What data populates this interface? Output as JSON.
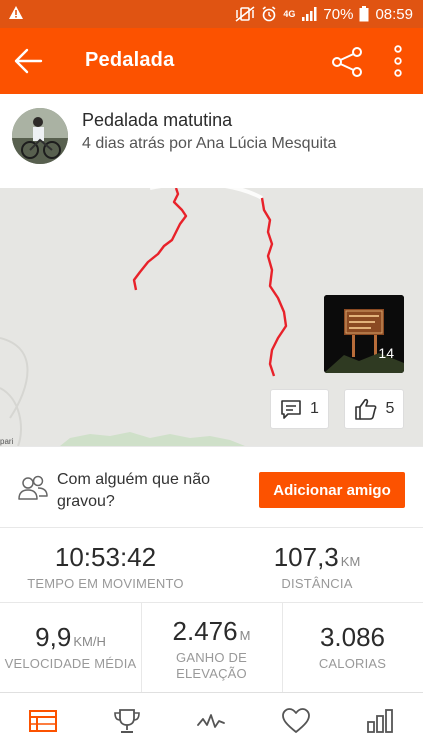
{
  "status_bar": {
    "battery": "70%",
    "time": "08:59",
    "network": "4G",
    "icons": [
      "warning-icon",
      "mute-vibrate-icon",
      "alarm-icon",
      "network-4g-icon",
      "signal-icon",
      "battery-icon"
    ]
  },
  "app_bar": {
    "title": "Pedalada",
    "icons": [
      "back-arrow-icon",
      "share-icon",
      "more-vertical-icon"
    ]
  },
  "activity": {
    "title": "Pedalada matutina",
    "subtitle": "4 dias atrás por Ana Lúcia Mesquita"
  },
  "map": {
    "photo_count": "14",
    "comments_count": "1",
    "kudos_count": "5",
    "brand_fragment": "pari",
    "route_color": "#e8222a"
  },
  "friend_prompt": {
    "question": "Com alguém que não gravou?",
    "button_label": "Adicionar amigo"
  },
  "stats": {
    "moving_time": {
      "value": "10:53:42",
      "label": "TEMPO EM MOVIMENTO"
    },
    "distance": {
      "value": "107,3",
      "unit": "KM",
      "label": "DISTÂNCIA"
    },
    "avg_speed": {
      "value": "9,9",
      "unit": "KM/H",
      "label": "VELOCIDADE MÉDIA"
    },
    "elevation": {
      "value": "2.476",
      "unit": "M",
      "label": "GANHO DE ELEVAÇÃO"
    },
    "calories": {
      "value": "3.086",
      "label": "CALORIAS"
    }
  },
  "bottom_nav": {
    "items": [
      "feed-icon",
      "trophy-icon",
      "activity-pulse-icon",
      "heart-icon",
      "stats-bars-icon"
    ],
    "active": "feed-icon"
  },
  "colors": {
    "brand_orange": "#fc5200",
    "status_bar": "#e05412"
  }
}
